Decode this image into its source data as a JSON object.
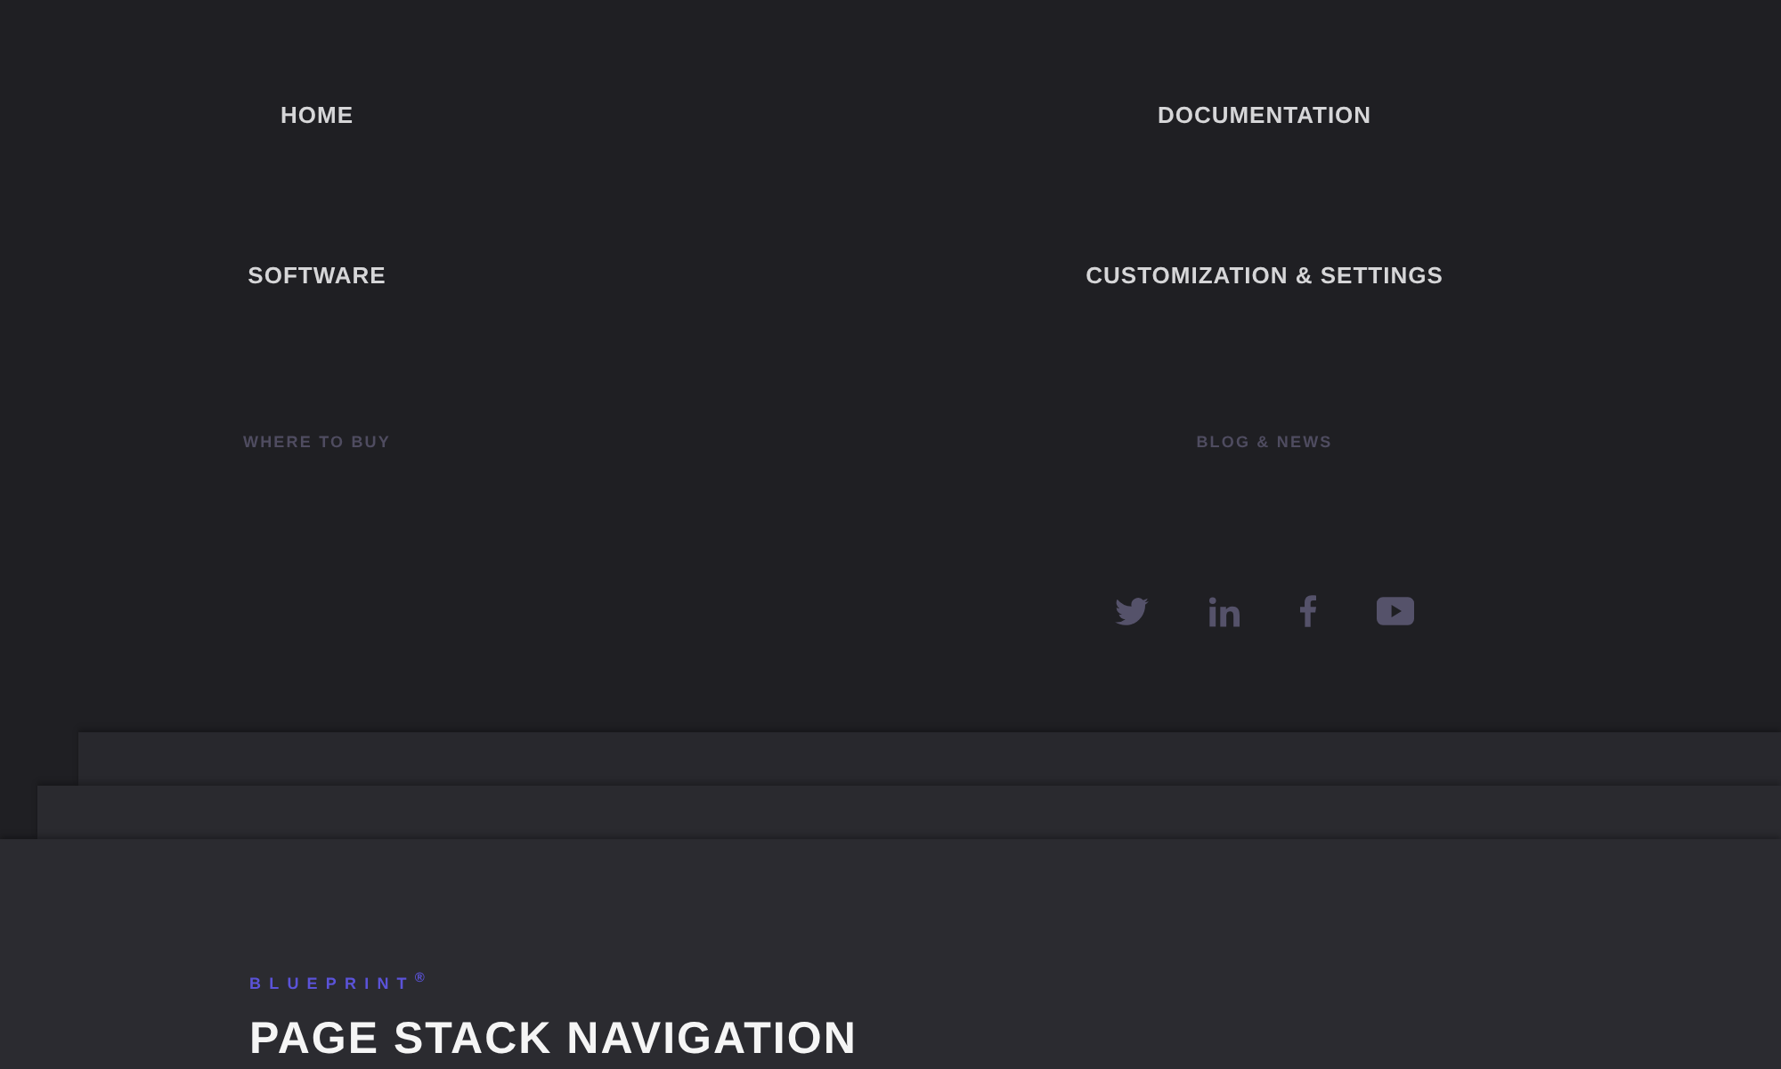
{
  "nav": {
    "columns": [
      {
        "items": [
          {
            "label": "HOME",
            "kind": "primary"
          },
          {
            "label": "SOFTWARE",
            "kind": "primary"
          },
          {
            "label": "WHERE TO BUY",
            "kind": "secondary"
          }
        ]
      },
      {
        "items": [
          {
            "label": "DOCUMENTATION",
            "kind": "primary"
          },
          {
            "label": "CUSTOMIZATION & SETTINGS",
            "kind": "primary"
          },
          {
            "label": "BLOG & NEWS",
            "kind": "secondary"
          }
        ],
        "social": [
          {
            "kind": "bird"
          },
          {
            "kind": "in"
          },
          {
            "kind": "f"
          },
          {
            "kind": "play"
          }
        ]
      }
    ]
  },
  "page": {
    "brand": "BLUEPRINT$^{®}$",
    "title": "PAGE STACK NAVIGATION"
  }
}
